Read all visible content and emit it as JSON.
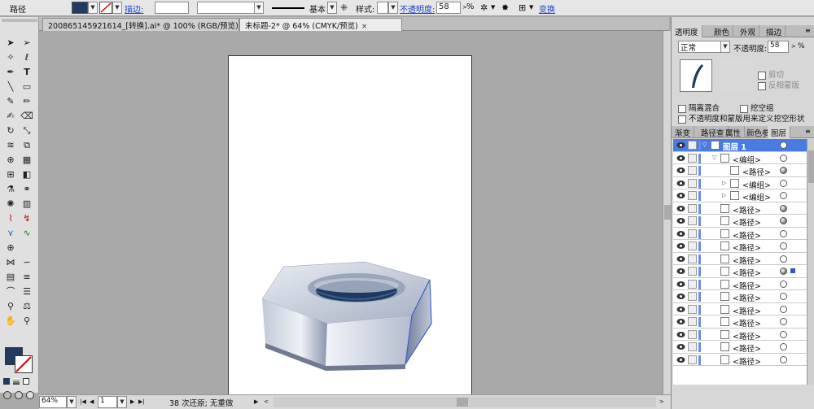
{
  "control_bar": {
    "object_type": "路径",
    "stroke_link": "描边:",
    "stroke_style": "基本",
    "style_label": "样式:",
    "opacity_link": "不透明度:",
    "opacity_value": "58",
    "opacity_unit": "%",
    "transform_link": "变换",
    "fill_color": "#1f3b5e"
  },
  "tabs": [
    {
      "label": "200865145921614_[转换].ai* @ 100% (RGB/预览)",
      "close": "×"
    },
    {
      "label": "未标题-2* @ 64% (CMYK/预览)",
      "close": "×"
    }
  ],
  "status_bar": {
    "zoom": "64%",
    "page": "1",
    "message": "38 次还原; 无重做"
  },
  "transparency_panel": {
    "tabs": [
      "透明度",
      "颜色",
      "外观",
      "描边"
    ],
    "blend_mode": "正常",
    "opacity_label": "不透明度:",
    "opacity_value": "58",
    "opacity_unit": "%",
    "clip_label": "剪切",
    "invert_mask_label": "反相蒙版",
    "isolate_blending_label": "隔离混合",
    "knockout_group_label": "挖空组",
    "opacity_mask_label": "不透明度和蒙版用来定义挖空形状"
  },
  "layers_panel": {
    "tabs": [
      "渐变",
      "路径查",
      "属性",
      "颜色参",
      "图层"
    ],
    "rows": [
      {
        "name": "图层 1",
        "level": 0
      },
      {
        "name": "<编组>",
        "level": 1
      },
      {
        "name": "<路径>",
        "level": 2
      },
      {
        "name": "<编组>",
        "level": 2
      },
      {
        "name": "<编组>",
        "level": 2
      },
      {
        "name": "<路径>",
        "level": 1
      },
      {
        "name": "<路径>",
        "level": 1
      },
      {
        "name": "<路径>",
        "level": 1
      },
      {
        "name": "<路径>",
        "level": 1
      },
      {
        "name": "<路径>",
        "level": 1
      },
      {
        "name": "<路径>",
        "level": 1
      },
      {
        "name": "<路径>",
        "level": 1
      },
      {
        "name": "<路径>",
        "level": 1
      },
      {
        "name": "<路径>",
        "level": 1
      },
      {
        "name": "<路径>",
        "level": 1
      },
      {
        "name": "<路径>",
        "level": 1
      },
      {
        "name": "<路径>",
        "level": 1
      },
      {
        "name": "<路径>",
        "level": 1
      }
    ]
  },
  "colors": {
    "selection_blue": "#4a7be0",
    "fill_swatch": "#1f3b5e"
  }
}
